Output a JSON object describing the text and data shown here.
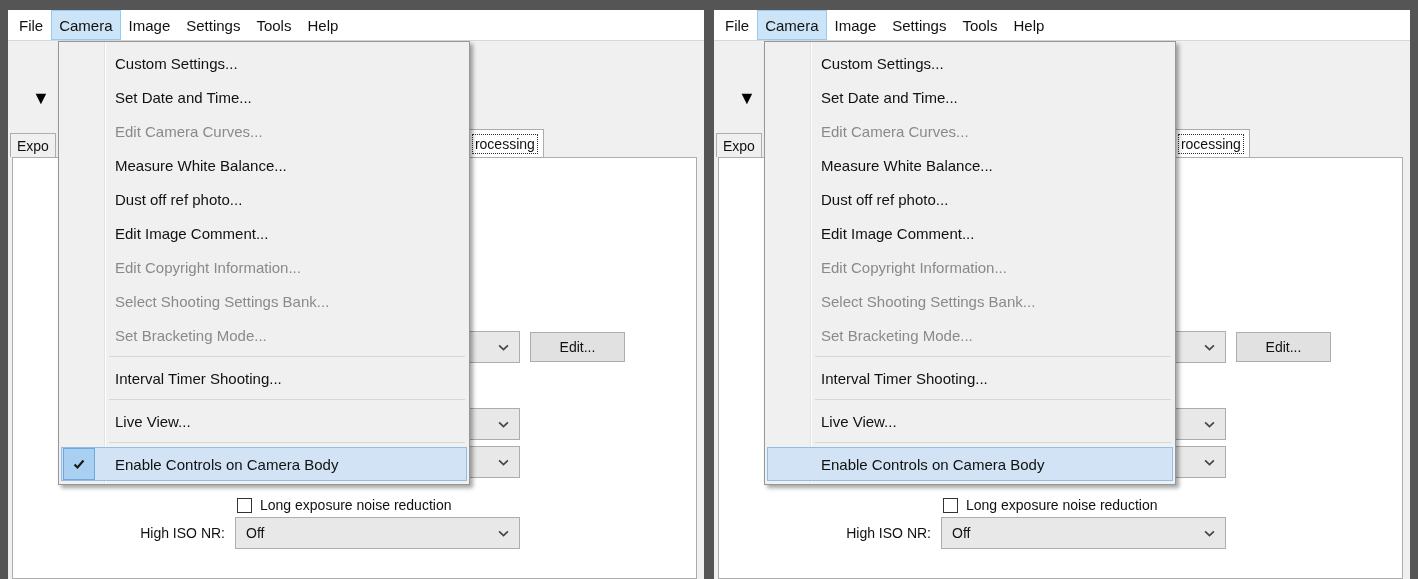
{
  "panels": [
    {
      "menubar": [
        {
          "label": "File",
          "selected": false
        },
        {
          "label": "Camera",
          "selected": true
        },
        {
          "label": "Image",
          "selected": false
        },
        {
          "label": "Settings",
          "selected": false
        },
        {
          "label": "Tools",
          "selected": false
        },
        {
          "label": "Help",
          "selected": false
        }
      ],
      "toolbar_glyph": "▼",
      "tabs": [
        {
          "label": "Expo",
          "selected": false
        },
        {
          "label": "rocessing",
          "selected": true
        }
      ],
      "edit_button": "Edit...",
      "checkbox": {
        "label": "Long exposure noise reduction",
        "checked": false
      },
      "high_iso": {
        "label": "High ISO NR:",
        "value": "Off"
      },
      "menu": [
        {
          "kind": "item",
          "label": "Custom Settings...",
          "disabled": false,
          "checked": false,
          "selected": false
        },
        {
          "kind": "item",
          "label": "Set Date and Time...",
          "disabled": false,
          "checked": false,
          "selected": false
        },
        {
          "kind": "item",
          "label": "Edit Camera Curves...",
          "disabled": true,
          "checked": false,
          "selected": false
        },
        {
          "kind": "item",
          "label": "Measure White Balance...",
          "disabled": false,
          "checked": false,
          "selected": false
        },
        {
          "kind": "item",
          "label": "Dust off ref photo...",
          "disabled": false,
          "checked": false,
          "selected": false
        },
        {
          "kind": "item",
          "label": "Edit Image Comment...",
          "disabled": false,
          "checked": false,
          "selected": false
        },
        {
          "kind": "item",
          "label": "Edit Copyright Information...",
          "disabled": true,
          "checked": false,
          "selected": false
        },
        {
          "kind": "item",
          "label": "Select Shooting Settings Bank...",
          "disabled": true,
          "checked": false,
          "selected": false
        },
        {
          "kind": "item",
          "label": "Set Bracketing Mode...",
          "disabled": true,
          "checked": false,
          "selected": false
        },
        {
          "kind": "separator"
        },
        {
          "kind": "item",
          "label": "Interval Timer Shooting...",
          "disabled": false,
          "checked": false,
          "selected": false
        },
        {
          "kind": "separator"
        },
        {
          "kind": "item",
          "label": "Live View...",
          "disabled": false,
          "checked": false,
          "selected": false
        },
        {
          "kind": "separator"
        },
        {
          "kind": "item",
          "label": "Enable Controls on Camera Body",
          "disabled": false,
          "checked": true,
          "selected": true
        }
      ]
    },
    {
      "menubar": [
        {
          "label": "File",
          "selected": false
        },
        {
          "label": "Camera",
          "selected": true
        },
        {
          "label": "Image",
          "selected": false
        },
        {
          "label": "Settings",
          "selected": false
        },
        {
          "label": "Tools",
          "selected": false
        },
        {
          "label": "Help",
          "selected": false
        }
      ],
      "toolbar_glyph": "▼",
      "tabs": [
        {
          "label": "Expo",
          "selected": false
        },
        {
          "label": "rocessing",
          "selected": true
        }
      ],
      "edit_button": "Edit...",
      "checkbox": {
        "label": "Long exposure noise reduction",
        "checked": false
      },
      "high_iso": {
        "label": "High ISO NR:",
        "value": "Off"
      },
      "menu": [
        {
          "kind": "item",
          "label": "Custom Settings...",
          "disabled": false,
          "checked": false,
          "selected": false
        },
        {
          "kind": "item",
          "label": "Set Date and Time...",
          "disabled": false,
          "checked": false,
          "selected": false
        },
        {
          "kind": "item",
          "label": "Edit Camera Curves...",
          "disabled": true,
          "checked": false,
          "selected": false
        },
        {
          "kind": "item",
          "label": "Measure White Balance...",
          "disabled": false,
          "checked": false,
          "selected": false
        },
        {
          "kind": "item",
          "label": "Dust off ref photo...",
          "disabled": false,
          "checked": false,
          "selected": false
        },
        {
          "kind": "item",
          "label": "Edit Image Comment...",
          "disabled": false,
          "checked": false,
          "selected": false
        },
        {
          "kind": "item",
          "label": "Edit Copyright Information...",
          "disabled": true,
          "checked": false,
          "selected": false
        },
        {
          "kind": "item",
          "label": "Select Shooting Settings Bank...",
          "disabled": true,
          "checked": false,
          "selected": false
        },
        {
          "kind": "item",
          "label": "Set Bracketing Mode...",
          "disabled": true,
          "checked": false,
          "selected": false
        },
        {
          "kind": "separator"
        },
        {
          "kind": "item",
          "label": "Interval Timer Shooting...",
          "disabled": false,
          "checked": false,
          "selected": false
        },
        {
          "kind": "separator"
        },
        {
          "kind": "item",
          "label": "Live View...",
          "disabled": false,
          "checked": false,
          "selected": false
        },
        {
          "kind": "separator"
        },
        {
          "kind": "item",
          "label": "Enable Controls on Camera Body",
          "disabled": false,
          "checked": false,
          "selected": true
        }
      ]
    }
  ]
}
